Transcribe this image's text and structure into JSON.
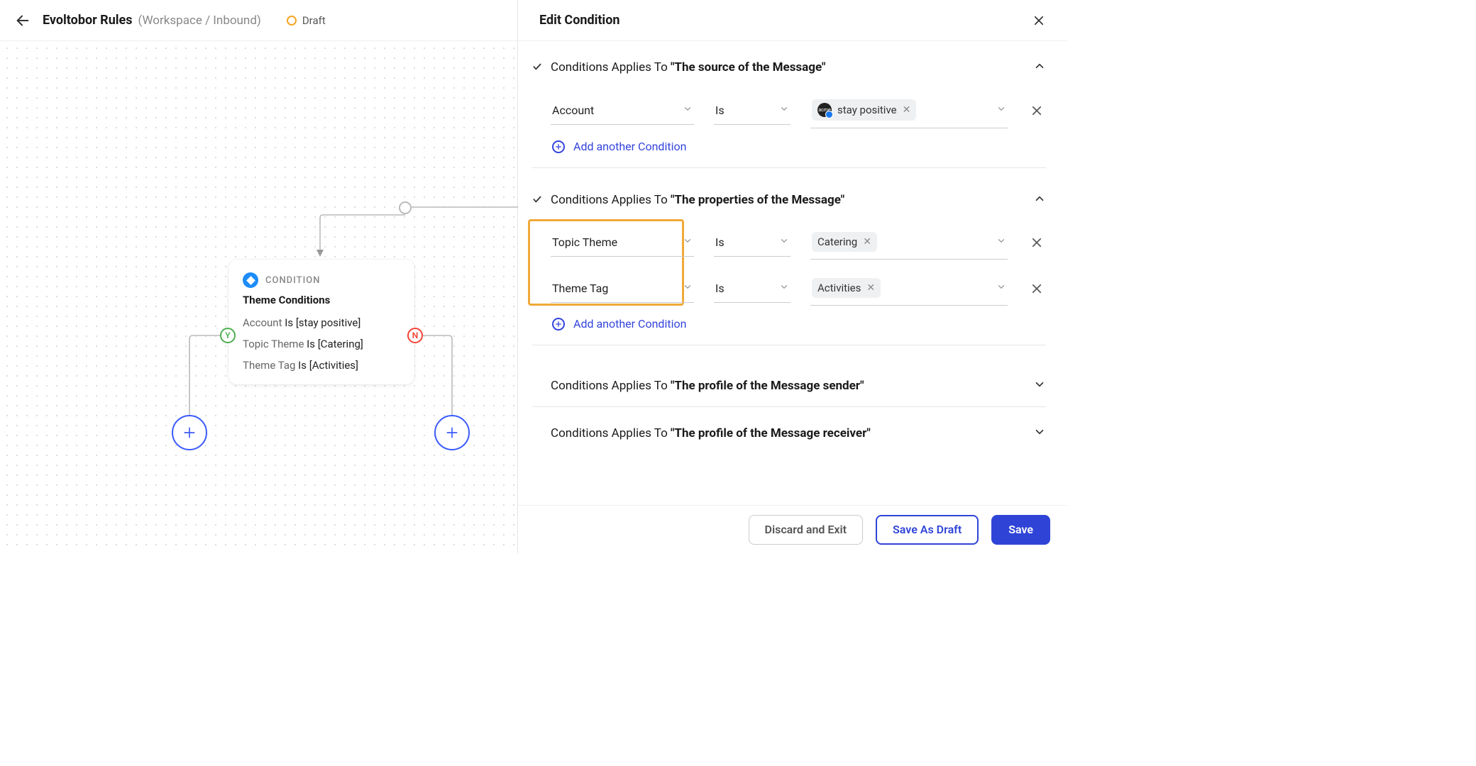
{
  "header": {
    "title": "Evoltobor Rules",
    "breadcrumb": "(Workspace / Inbound)",
    "status": "Draft"
  },
  "node": {
    "type": "CONDITION",
    "title": "Theme Conditions",
    "rules": [
      {
        "field": "Account",
        "op": "Is",
        "value": "[stay positive]"
      },
      {
        "field": "Topic Theme",
        "op": "Is",
        "value": "[Catering]"
      },
      {
        "field": "Theme Tag",
        "op": "Is",
        "value": "[Activities]"
      }
    ],
    "yes": "Y",
    "no": "N"
  },
  "panel": {
    "title": "Edit Condition",
    "applies_prefix": "Conditions Applies To",
    "sections": [
      {
        "target": "\"The source of the Message\"",
        "expanded": true,
        "rows": [
          {
            "field": "Account",
            "op": "Is",
            "value": "stay positive",
            "avatar": "acme",
            "avatar_style": true
          }
        ]
      },
      {
        "target": "\"The properties of the Message\"",
        "expanded": true,
        "highlight": true,
        "rows": [
          {
            "field": "Topic Theme",
            "op": "Is",
            "value": "Catering"
          },
          {
            "field": "Theme Tag",
            "op": "Is",
            "value": "Activities"
          }
        ]
      },
      {
        "target": "\"The profile of the Message sender\"",
        "expanded": false
      },
      {
        "target": "\"The profile of the Message receiver\"",
        "expanded": false
      }
    ],
    "add_condition": "Add another Condition"
  },
  "footer": {
    "discard": "Discard and Exit",
    "draft": "Save As Draft",
    "save": "Save"
  }
}
